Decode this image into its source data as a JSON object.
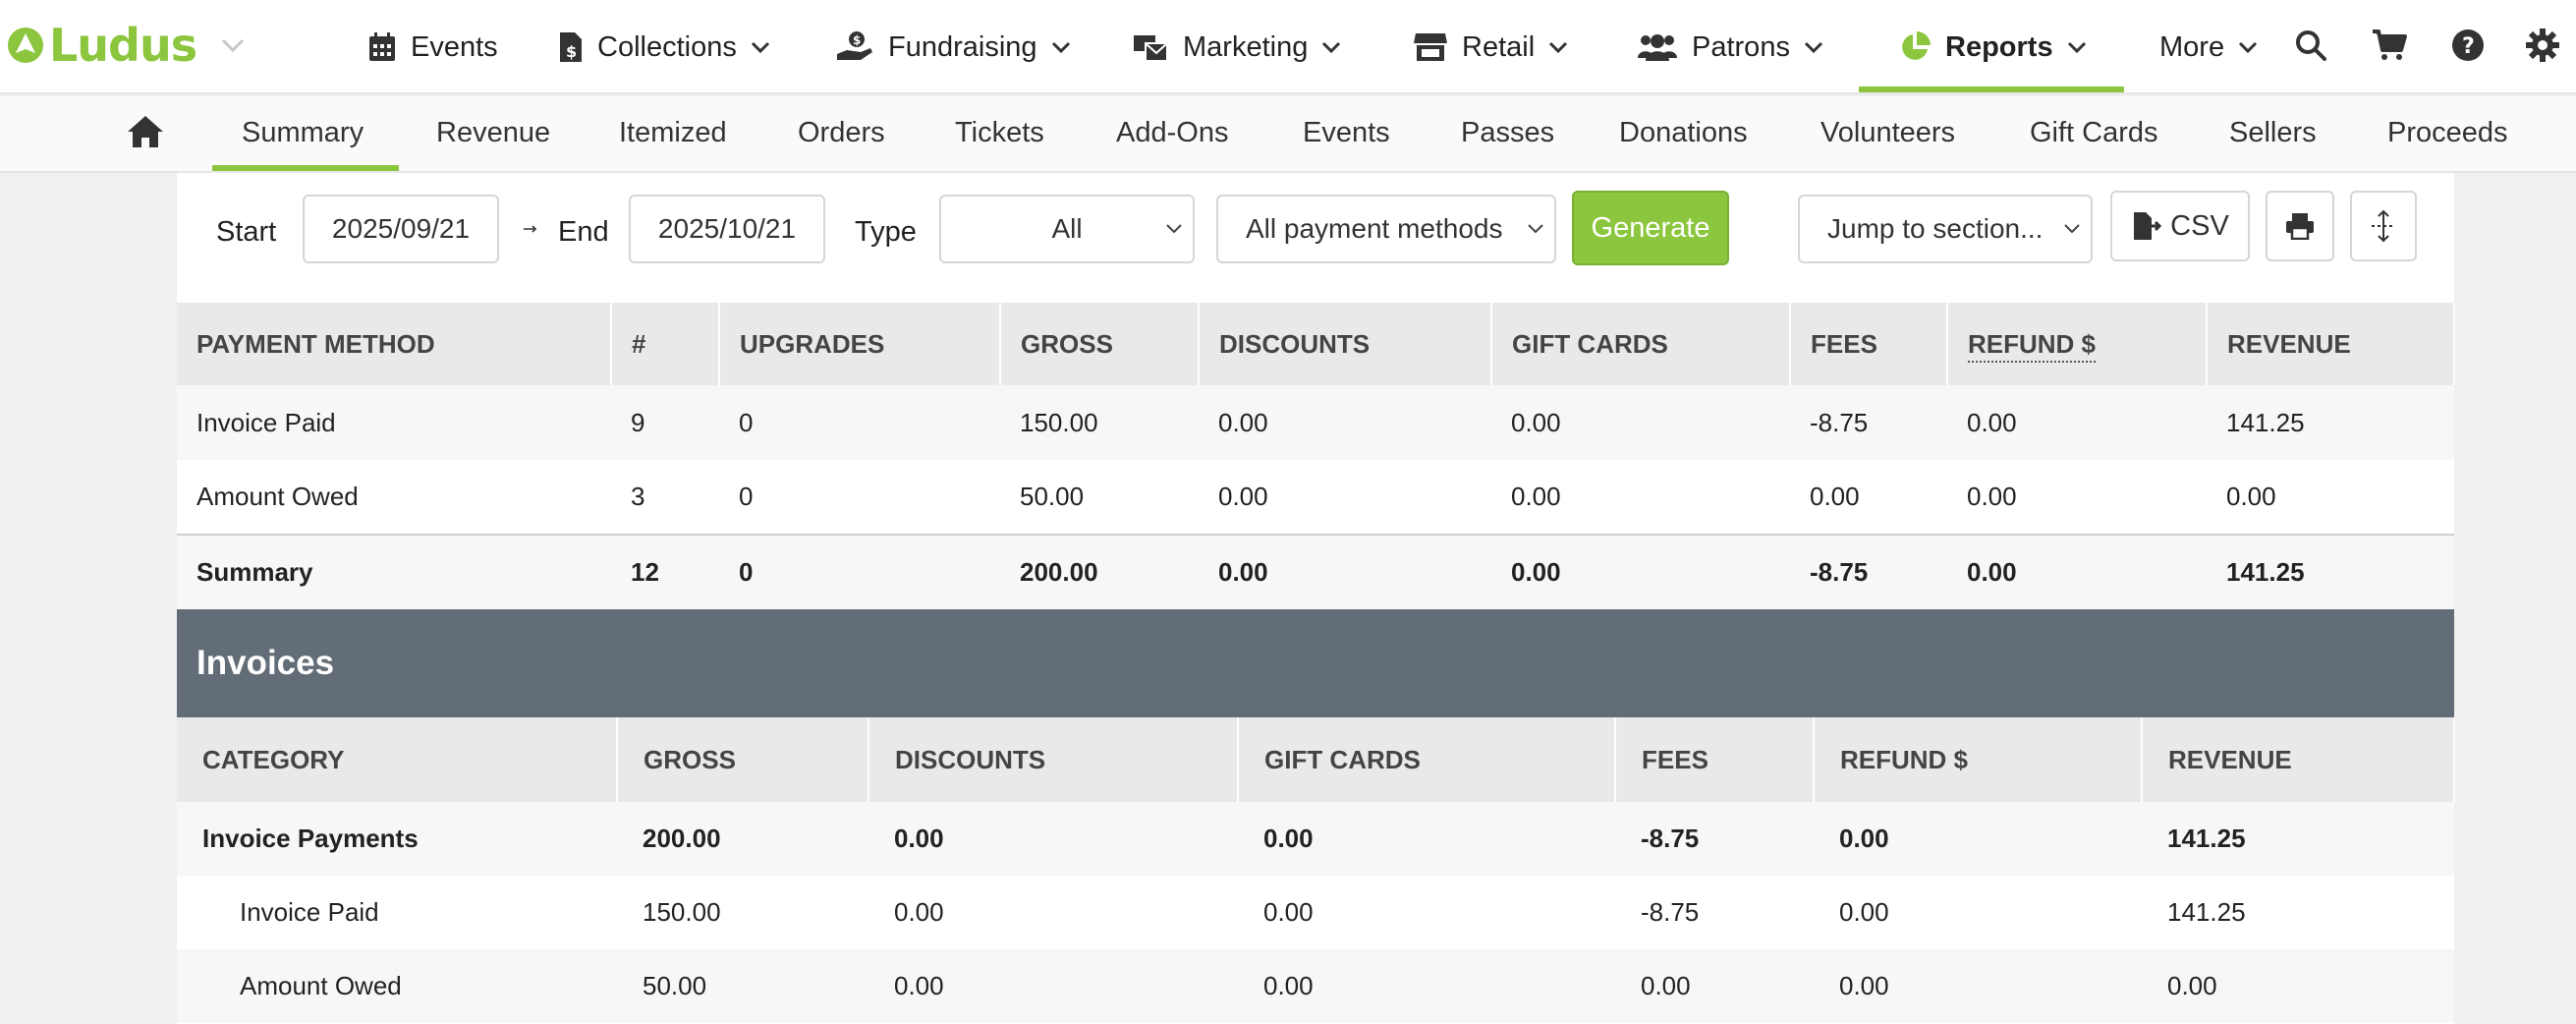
{
  "brand": {
    "name": "Ludus",
    "accent": "#8cc63f"
  },
  "nav": {
    "items": [
      {
        "label": "Events"
      },
      {
        "label": "Collections"
      },
      {
        "label": "Fundraising"
      },
      {
        "label": "Marketing"
      },
      {
        "label": "Retail"
      },
      {
        "label": "Patrons"
      },
      {
        "label": "Reports"
      },
      {
        "label": "More"
      }
    ],
    "active": "Reports",
    "icons": [
      "search-icon",
      "cart-icon",
      "help-icon",
      "gear-icon"
    ]
  },
  "subtabs": {
    "items": [
      "Summary",
      "Revenue",
      "Itemized",
      "Orders",
      "Tickets",
      "Add-Ons",
      "Events",
      "Passes",
      "Donations",
      "Volunteers",
      "Gift Cards",
      "Sellers",
      "Proceeds"
    ],
    "active": "Summary"
  },
  "controls": {
    "start_label": "Start",
    "start_value": "2025/09/21",
    "end_label": "End",
    "end_value": "2025/10/21",
    "type_label": "Type",
    "type_value": "All",
    "payment_value": "All payment methods",
    "generate_label": "Generate",
    "jump_value": "Jump to section...",
    "csv_label": "CSV"
  },
  "payment_table": {
    "headers": [
      "Payment Method",
      "#",
      "Upgrades",
      "Gross",
      "Discounts",
      "Gift Cards",
      "Fees",
      "Refund $",
      "Revenue"
    ],
    "rows": [
      [
        "Invoice Paid",
        "9",
        "0",
        "150.00",
        "0.00",
        "0.00",
        "-8.75",
        "0.00",
        "141.25"
      ],
      [
        "Amount Owed",
        "3",
        "0",
        "50.00",
        "0.00",
        "0.00",
        "0.00",
        "0.00",
        "0.00"
      ]
    ],
    "summary": [
      "Summary",
      "12",
      "0",
      "200.00",
      "0.00",
      "0.00",
      "-8.75",
      "0.00",
      "141.25"
    ]
  },
  "invoices": {
    "title": "Invoices",
    "headers": [
      "Category",
      "Gross",
      "Discounts",
      "Gift Cards",
      "Fees",
      "Refund $",
      "Revenue"
    ],
    "rows": [
      [
        "Invoice Payments",
        "200.00",
        "0.00",
        "0.00",
        "-8.75",
        "0.00",
        "141.25"
      ],
      [
        "Invoice Paid",
        "150.00",
        "0.00",
        "0.00",
        "-8.75",
        "0.00",
        "141.25"
      ],
      [
        "Amount Owed",
        "50.00",
        "0.00",
        "0.00",
        "0.00",
        "0.00",
        "0.00"
      ]
    ]
  }
}
